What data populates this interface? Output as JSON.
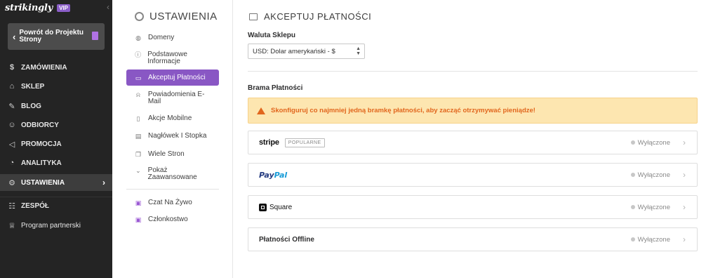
{
  "brand": {
    "logo": "strikingly",
    "badge": "VIP"
  },
  "sidebar": {
    "back_label": "Powrót do Projektu Strony",
    "items": [
      {
        "label": "ZAMÓWIENIA",
        "icon": "dollar-circle-icon"
      },
      {
        "label": "SKLEP",
        "icon": "store-icon"
      },
      {
        "label": "BLOG",
        "icon": "pen-icon"
      },
      {
        "label": "ODBIORCY",
        "icon": "people-icon"
      },
      {
        "label": "PROMOCJA",
        "icon": "megaphone-icon"
      },
      {
        "label": "ANALITYKA",
        "icon": "chart-icon"
      },
      {
        "label": "USTAWIENIA",
        "icon": "gear-icon",
        "active": true
      },
      {
        "label": "ZESPÓŁ",
        "icon": "team-icon"
      },
      {
        "label": "Program partnerski",
        "icon": "trophy-icon"
      }
    ]
  },
  "settings": {
    "title": "USTAWIENIA",
    "items": [
      {
        "label": "Domeny",
        "icon": "globe-icon"
      },
      {
        "label": "Podstawowe Informacje",
        "icon": "info-icon"
      },
      {
        "label": "Akceptuj Płatności",
        "icon": "card-icon",
        "active": true
      },
      {
        "label": "Powiadomienia E-Mail",
        "icon": "bell-icon"
      },
      {
        "label": "Akcje Mobilne",
        "icon": "mobile-icon"
      },
      {
        "label": "Nagłówek I Stopka",
        "icon": "layout-icon"
      },
      {
        "label": "Wiele Stron",
        "icon": "pages-icon"
      },
      {
        "label": "Pokaż Zaawansowane",
        "icon": "chevron-down-icon"
      },
      {
        "label": "Czat Na Żywo",
        "icon": "chat-icon"
      },
      {
        "label": "Członkostwo",
        "icon": "member-icon"
      }
    ]
  },
  "main": {
    "title": "AKCEPTUJ PŁATNOŚCI",
    "currency_label": "Waluta Sklepu",
    "currency_value": "USD: Dolar amerykański - $",
    "gateway_label": "Brama Płatności",
    "alert": "Skonfiguruj co najmniej jedną bramkę płatności, aby zacząć otrzymywać pieniądze!",
    "gateways": [
      {
        "name": "stripe",
        "badge": "POPULARNE",
        "status": "Wyłączone"
      },
      {
        "name_a": "Pay",
        "name_b": "Pal",
        "status": "Wyłączone"
      },
      {
        "name": "Square",
        "status": "Wyłączone"
      },
      {
        "name": "Płatności Offline",
        "status": "Wyłączone"
      }
    ]
  },
  "colors": {
    "accent": "#8957c4",
    "sidebar_bg": "#242424",
    "alert_bg": "#fde6b0",
    "alert_text": "#e1661d"
  }
}
